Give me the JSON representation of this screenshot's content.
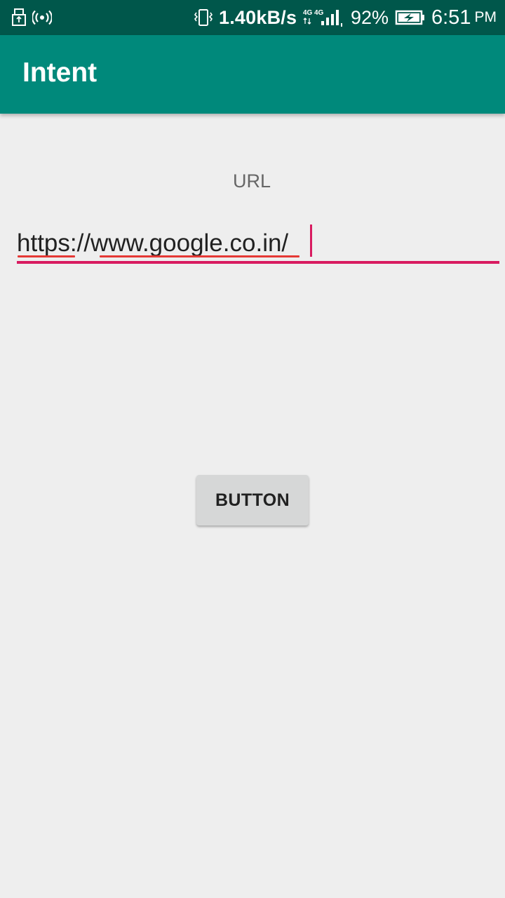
{
  "status_bar": {
    "icons": [
      "usb-icon",
      "hotspot-icon",
      "vibrate-icon",
      "network-icon",
      "battery-charging-icon"
    ],
    "net_speed": "1.40kB/s",
    "network_labels": [
      "4G",
      "4G"
    ],
    "battery_percent": "92%",
    "battery_level": 0.92,
    "time": "6:51",
    "ampm": "PM"
  },
  "app_bar": {
    "title": "Intent",
    "color": "#00897b"
  },
  "form": {
    "label": "URL",
    "url_value": "https://www.google.co.in/",
    "accent_color": "#d81b60"
  },
  "button": {
    "label": "BUTTON"
  }
}
